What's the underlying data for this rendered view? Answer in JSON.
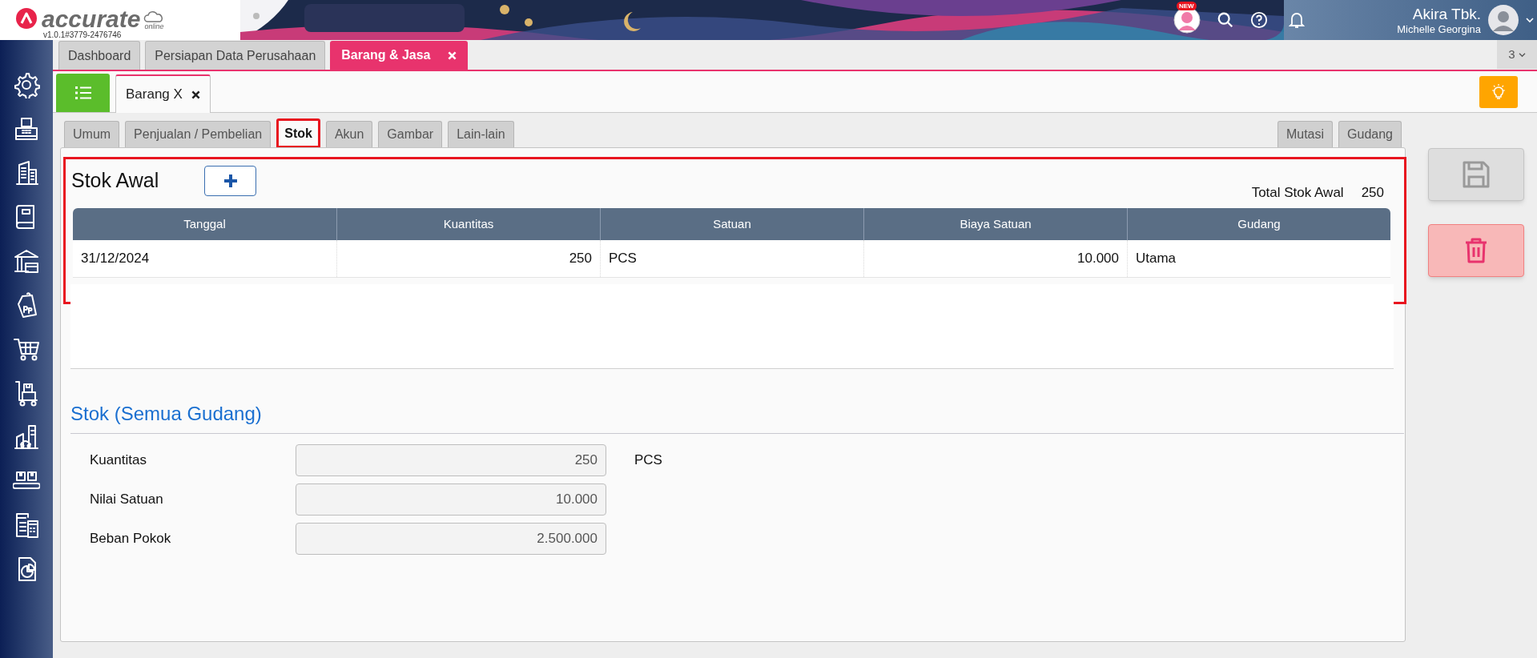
{
  "app": {
    "logo_text": "accurate",
    "logo_sub": "online",
    "version": "v1.0.1#3779-2476746"
  },
  "header": {
    "new_badge": "NEW",
    "user": {
      "company": "Akira Tbk.",
      "name": "Michelle Georgina"
    }
  },
  "main_tabs": [
    {
      "label": "Dashboard",
      "selected": false,
      "closable": false
    },
    {
      "label": "Persiapan Data Perusahaan",
      "selected": false,
      "closable": false
    },
    {
      "label": "Barang & Jasa",
      "selected": true,
      "closable": true
    }
  ],
  "tab_count": "3",
  "doc_tabs": [
    {
      "label": "Barang X",
      "selected": true,
      "closable": true
    }
  ],
  "form_tabs": [
    {
      "label": "Umum",
      "selected": false,
      "highlighted": false
    },
    {
      "label": "Penjualan / Pembelian",
      "selected": false,
      "highlighted": false
    },
    {
      "label": "Stok",
      "selected": true,
      "highlighted": true
    },
    {
      "label": "Akun",
      "selected": false,
      "highlighted": false
    },
    {
      "label": "Gambar",
      "selected": false,
      "highlighted": false
    },
    {
      "label": "Lain-lain",
      "selected": false,
      "highlighted": false
    }
  ],
  "right_tabs": [
    {
      "label": "Mutasi",
      "selected": false
    },
    {
      "label": "Gudang",
      "selected": false
    }
  ],
  "stok_awal": {
    "title": "Stok Awal",
    "highlighted": true,
    "total_label": "Total Stok Awal",
    "total_value": "250",
    "table": {
      "columns": [
        {
          "label": "Tanggal",
          "kind": "text"
        },
        {
          "label": "Kuantitas",
          "kind": "number"
        },
        {
          "label": "Satuan",
          "kind": "text"
        },
        {
          "label": "Biaya Satuan",
          "kind": "number"
        },
        {
          "label": "Gudang",
          "kind": "text"
        }
      ],
      "rows": [
        [
          "31/12/2024",
          "250",
          "PCS",
          "10.000",
          "Utama"
        ]
      ]
    }
  },
  "stok_semua": {
    "title": "Stok (Semua Gudang)",
    "fields": [
      {
        "label": "Kuantitas",
        "value": "250",
        "unit": "PCS",
        "disabled": true
      },
      {
        "label": "Nilai Satuan",
        "value": "10.000",
        "disabled": true
      },
      {
        "label": "Beban Pokok",
        "value": "2.500.000",
        "disabled": true
      }
    ]
  }
}
